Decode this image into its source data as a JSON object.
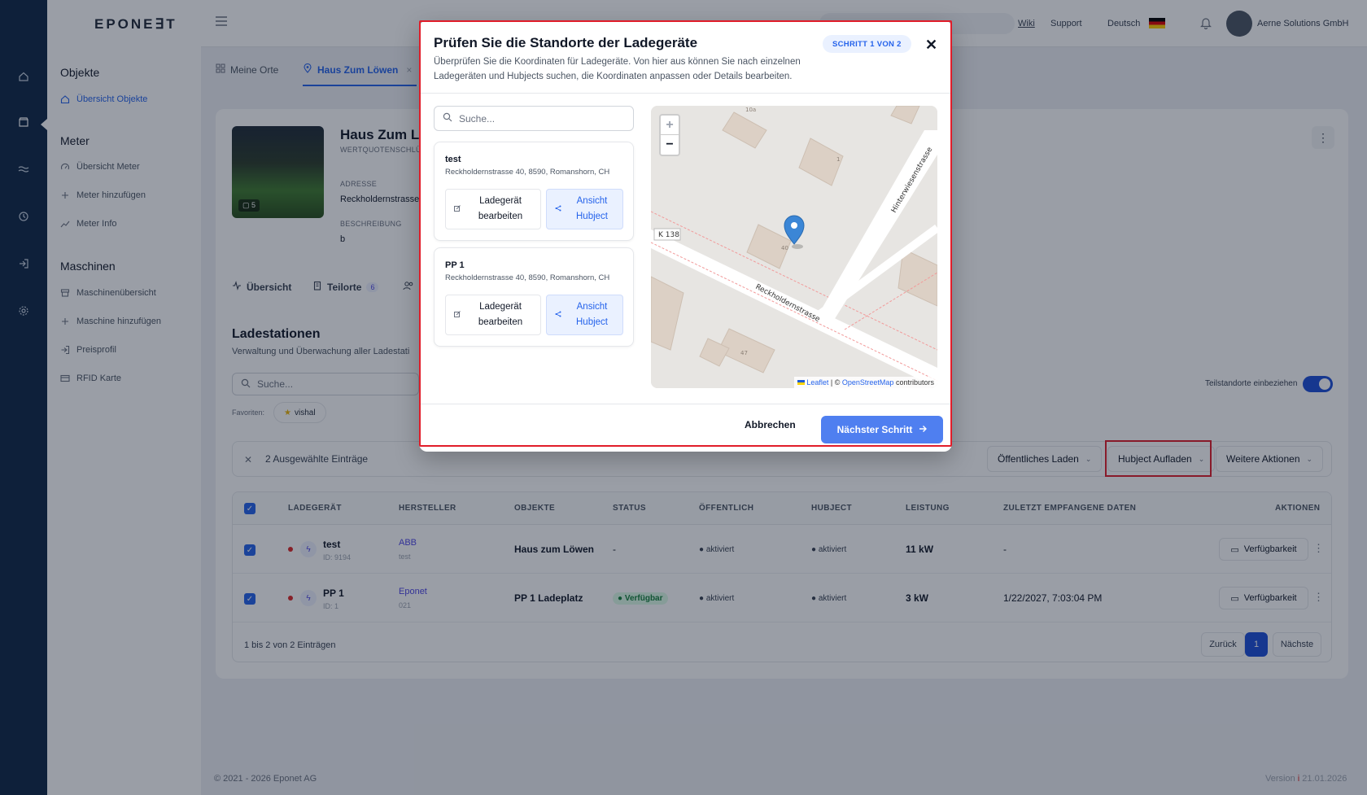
{
  "brand": {
    "logo": "EPONE∃T"
  },
  "topbar": {
    "links": [
      "Wiki",
      "Support",
      "Deutsch"
    ],
    "company": "Aerne Solutions GmbH"
  },
  "sidebar": {
    "sections": [
      {
        "title": "Objekte",
        "items": [
          "Übersicht Objekte"
        ]
      },
      {
        "title": "Meter",
        "items": [
          "Übersicht Meter",
          "Meter hinzufügen",
          "Meter Info"
        ]
      },
      {
        "title": "Maschinen",
        "items": [
          "Maschinenübersicht",
          "Maschine hinzufügen",
          "Preisprofil",
          "RFID Karte"
        ]
      }
    ]
  },
  "page_tabs": [
    "Meine Orte",
    "Haus Zum Löwen"
  ],
  "place": {
    "title": "Haus Zum L",
    "subtitle": "WERTQUOTENSCHLÜ",
    "photo_count": "5",
    "address_label": "ADRESSE",
    "address": "Reckholdernstrasse",
    "description_label": "BESCHREIBUNG",
    "description": "b"
  },
  "inner_tabs": [
    {
      "label": "Übersicht"
    },
    {
      "label": "Teilorte",
      "badge": "6"
    }
  ],
  "stations": {
    "title": "Ladestationen",
    "subtitle": "Verwaltung und Überwachung aller Ladestati",
    "search_placeholder": "Suche...",
    "favorites_label": "Favoriten:",
    "favorite": "vishal",
    "toggle_label": "Teilstandorte einbeziehen",
    "selected_text": "2 Ausgewählte Einträge",
    "actions": [
      "Öffentliches Laden",
      "Hubject Aufladen",
      "Weitere Aktionen"
    ],
    "columns": [
      "LADEGERÄT",
      "HERSTELLER",
      "OBJEKTE",
      "STATUS",
      "ÖFFENTLICH",
      "HUBJECT",
      "LEISTUNG",
      "ZULETZT EMPFANGENE DATEN",
      "AKTIONEN"
    ],
    "rows": [
      {
        "name": "test",
        "id": "ID: 9194",
        "maker": "ABB",
        "maker_sub": "test",
        "object": "Haus zum Löwen",
        "status": "-",
        "public": "aktiviert",
        "hubject": "aktiviert",
        "power": "11 kW",
        "last": "-",
        "action": "Verfügbarkeit"
      },
      {
        "name": "PP 1",
        "id": "ID: 1",
        "maker": "Eponet",
        "maker_sub": "021",
        "object": "PP 1 Ladeplatz",
        "status": "Verfügbar",
        "public": "aktiviert",
        "hubject": "aktiviert",
        "power": "3 kW",
        "last": "1/22/2027, 7:03:04 PM",
        "action": "Verfügbarkeit"
      }
    ],
    "footer": "1 bis 2 von 2 Einträgen",
    "pager": [
      "Zurück",
      "1",
      "Nächste"
    ]
  },
  "footer": {
    "copyright": "© 2021 - 2026 Eponet AG",
    "version": "Version",
    "date": "21.01.2026"
  },
  "modal": {
    "title": "Prüfen Sie die Standorte der Ladegeräte",
    "description": "Überprüfen Sie die Koordinaten für Ladegeräte. Von hier aus können Sie nach einzelnen Ladegeräten und Hubjects suchen, die Koordinaten anpassen oder Details bearbeiten.",
    "step": "SCHRITT 1 VON 2",
    "search_placeholder": "Suche...",
    "locations": [
      {
        "name": "test",
        "address": "Reckholdernstrasse 40, 8590, Romanshorn, CH",
        "edit_label": "Ladegerät bearbeiten",
        "view_label": "Ansicht Hubject"
      },
      {
        "name": "PP 1",
        "address": "Reckholdernstrasse 40, 8590, Romanshorn, CH",
        "edit_label": "Ladegerät bearbeiten",
        "view_label": "Ansicht Hubject"
      }
    ],
    "map": {
      "zoom_in": "+",
      "zoom_out": "−",
      "streets": [
        "Reckholdernstrasse",
        "Hinterwiesenstrasse"
      ],
      "road_label": "K 138",
      "house_numbers": [
        "10a",
        "1",
        "40",
        "47"
      ],
      "attribution_leaflet": "Leaflet",
      "attribution_mid": "| ©",
      "attribution_osm": "OpenStreetMap",
      "attribution_end": "contributors"
    },
    "cancel": "Abbrechen",
    "next": "Nächster Schritt"
  },
  "colors": {
    "accent": "#2563eb",
    "highlight": "#e11d2a",
    "rail": "#0f2746"
  },
  "icons": [
    "home-icon",
    "store-icon",
    "waves-icon",
    "clock-icon",
    "login-icon",
    "gear-icon",
    "search-icon",
    "close-icon",
    "arrow-right-icon",
    "map-pin-icon",
    "edit-icon",
    "share-icon"
  ]
}
